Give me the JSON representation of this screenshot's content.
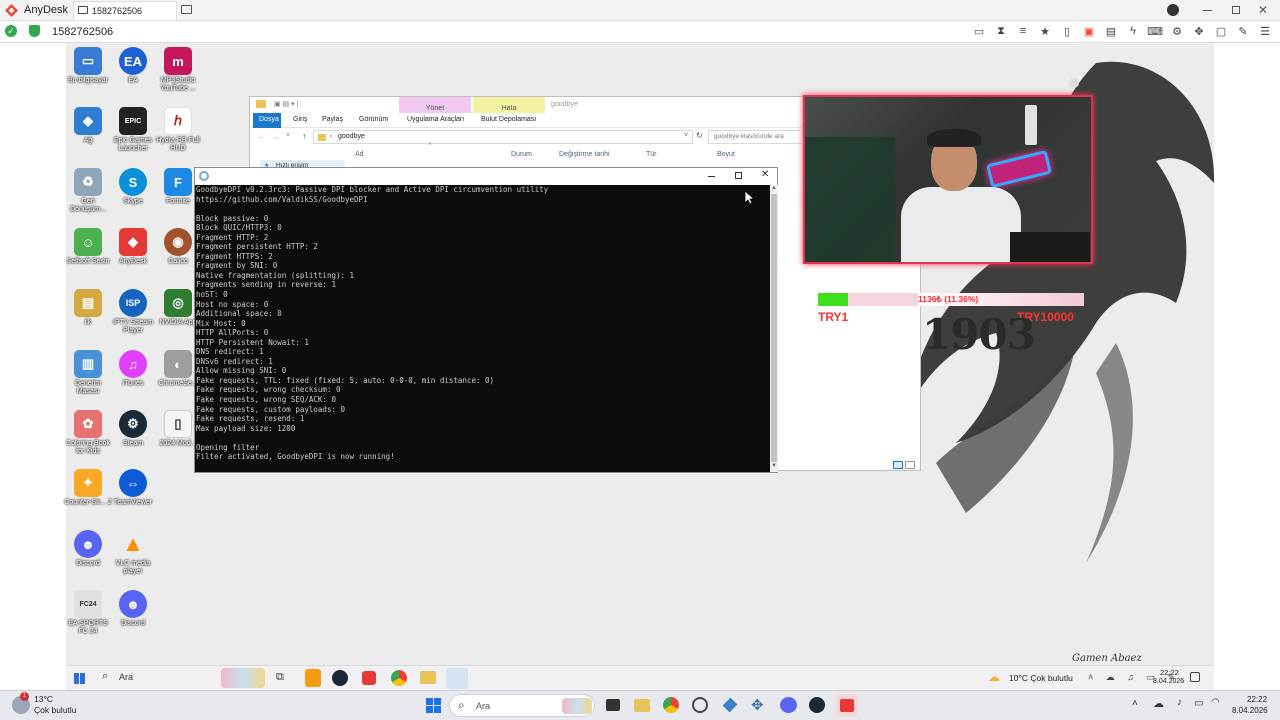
{
  "anydesk": {
    "app_name": "AnyDesk",
    "tab_label": "1582762506",
    "address": "1582762506"
  },
  "desktop_icons": [
    {
      "label": "Bu bilgisayar",
      "icon": "computer-icon",
      "color": "#3a7bd5"
    },
    {
      "label": "EA",
      "icon": "ea-icon",
      "color": "#1d5fd6"
    },
    {
      "label": "MP3Studio YouTube ...",
      "icon": "mp3studio-icon",
      "color": "#c2185b"
    },
    {
      "label": "Ağ",
      "icon": "network-icon",
      "color": "#2e7dd1"
    },
    {
      "label": "Epic Games Launcher",
      "icon": "epic-games-icon",
      "color": "#222222"
    },
    {
      "label": "Hydra RB Full HUD",
      "icon": "hydra-icon",
      "color": "#b71c1c"
    },
    {
      "label": "Geri Dönüşüm...",
      "icon": "recycle-bin-icon",
      "color": "#8fa6b8"
    },
    {
      "label": "Skype",
      "icon": "skype-icon",
      "color": "#0a8fd8"
    },
    {
      "label": "Fortnite",
      "icon": "fortnite-icon",
      "color": "#1e88e5"
    },
    {
      "label": "Selfsoft Sesin",
      "icon": "user-folder-icon",
      "color": "#4caf50"
    },
    {
      "label": "AnyDesk",
      "icon": "anydesk-icon",
      "color": "#e53935"
    },
    {
      "label": "Calico",
      "icon": "calico-icon",
      "color": "#a0522d"
    },
    {
      "label": "ilk",
      "icon": "folder-icon",
      "color": "#d4a942"
    },
    {
      "label": "IPTV Stream Player",
      "icon": "iptv-icon",
      "color": "#1565c0"
    },
    {
      "label": "NVIDIA App",
      "icon": "nvidia-icon",
      "color": "#2e7d32"
    },
    {
      "label": "Denetim Masası",
      "icon": "control-panel-icon",
      "color": "#4a90d9"
    },
    {
      "label": "iTunes",
      "icon": "itunes-icon",
      "color": "#e040fb"
    },
    {
      "label": "ChromeSe...",
      "icon": "chrome-setup-icon",
      "color": "#9e9e9e"
    },
    {
      "label": "Coloring Book for Kids",
      "icon": "coloring-book-icon",
      "color": "#e57373"
    },
    {
      "label": "Steam",
      "icon": "steam-icon",
      "color": "#1b2838"
    },
    {
      "label": "2024 Mod...",
      "icon": "file-icon",
      "color": "#f5f5f5"
    },
    {
      "label": "Counter-Str... 2",
      "icon": "cs2-icon",
      "color": "#f9a825"
    },
    {
      "label": "TeamViewer",
      "icon": "teamviewer-icon",
      "color": "#0e5bd8"
    },
    {
      "label": "Discord",
      "icon": "discord-icon",
      "color": "#5865f2"
    },
    {
      "label": "VLC media player",
      "icon": "vlc-icon",
      "color": "#ff8f00"
    },
    {
      "label": "EA SPORTS FC 24",
      "icon": "fc24-icon",
      "color": "#e0e0e0"
    },
    {
      "label": "Discord",
      "icon": "discord-icon",
      "color": "#5865f2"
    }
  ],
  "explorer": {
    "ribbon_tabs": [
      "Dosya",
      "Giriş",
      "Paylaş",
      "Görünüm"
    ],
    "context_group_1": "Yönet",
    "context_tab_1": "Uygulama Araçları",
    "context_group_2": "Hata",
    "context_tab_2": "Bulut Depolaması",
    "window_title": "goodbye",
    "path": "goodbye",
    "search_placeholder": "goodbye klasöründe ara",
    "columns": [
      "Ad",
      "Durum",
      "Değiştirme tarihi",
      "Tür",
      "Boyut"
    ],
    "nav_item": "Hızlı erişim"
  },
  "console": {
    "lines": [
      "GoodbyeDPI v0.2.3rc3: Passive DPI blocker and Active DPI circumvention utility",
      "https://github.com/ValdikSS/GoodbyeDPI",
      "",
      "Block passive: 0",
      "Block QUIC/HTTP3: 0",
      "Fragment HTTP: 2",
      "Fragment persistent HTTP: 2",
      "Fragment HTTPS: 2",
      "Fragment by SNI: 0",
      "Native fragmentation (splitting): 1",
      "Fragments sending in reverse: 1",
      "hoST: 0",
      "Host no space: 0",
      "Additional space: 0",
      "Mix Host: 0",
      "HTTP AllPorts: 0",
      "HTTP Persistent Nowait: 1",
      "DNS redirect: 1",
      "DNSv6 redirect: 1",
      "Allow missing SNI: 0",
      "Fake requests, TTL: fixed (fixed: 5, auto: 0-0-0, min distance: 0)",
      "Fake requests, wrong checksum: 0",
      "Fake requests, wrong SEQ/ACK: 0",
      "Fake requests, custom payloads: 0",
      "Fake requests, resend: 1",
      "Max payload size: 1200",
      "",
      "Opening filter",
      "Filter activated, GoodbyeDPI is now running!"
    ]
  },
  "overlay": {
    "goal_progress": "1136₺ (11.36%)",
    "goal_fraction": 0.1136,
    "left_label": "TRY1",
    "right_label": "TRY10000",
    "logo_text": "1903",
    "signature": "Gamen Abaez"
  },
  "remote_taskbar": {
    "search": "Ara",
    "weather": "10°C  Çok bulutlu",
    "time": "22:22",
    "date": "8.04.2026"
  },
  "local_taskbar": {
    "temp": "13°C",
    "weather": "Çok bulutlu",
    "search": "Ara",
    "notification_badge": "1",
    "time": "22:22",
    "date": "8.04.2026"
  },
  "colors": {
    "anydesk_red": "#ef443b",
    "ribbon_blue": "#1979ca",
    "yonet_bg": "#f0c8f0",
    "hata_bg": "#f2f2a0",
    "goal_green": "#3ee01c",
    "goal_red": "#ff3030"
  }
}
